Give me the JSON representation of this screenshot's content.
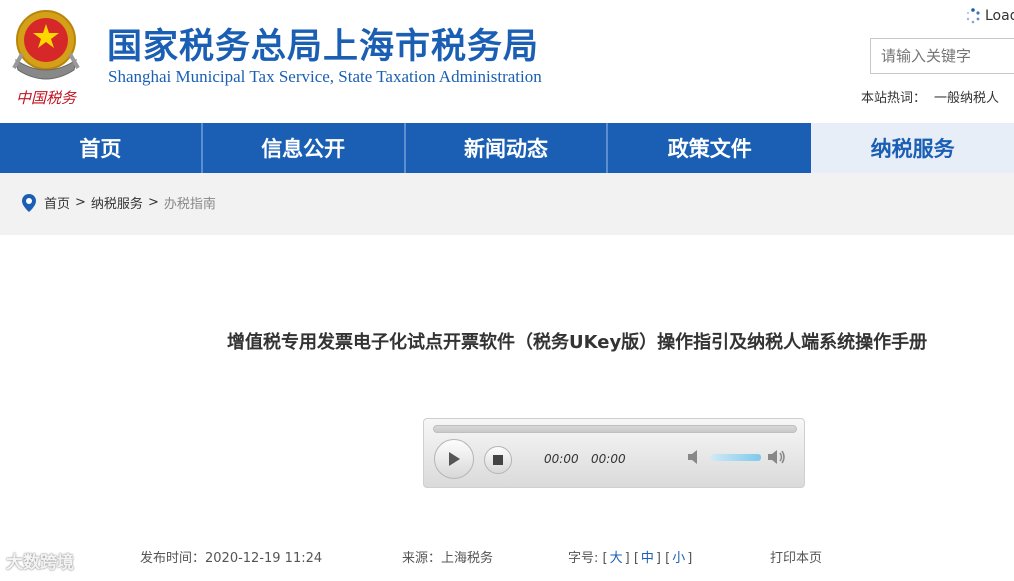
{
  "header": {
    "emblem_text": "中国税务",
    "title_cn": "国家税务总局上海市税务局",
    "title_en": "Shanghai Municipal Tax Service, State Taxation Administration",
    "loader_text": "Load",
    "search_placeholder": "请输入关键字",
    "hot_label": "本站热词：",
    "hot_word": "一般纳税人"
  },
  "nav": {
    "items": [
      {
        "label": "首页"
      },
      {
        "label": "信息公开"
      },
      {
        "label": "新闻动态"
      },
      {
        "label": "政策文件"
      },
      {
        "label": "纳税服务"
      }
    ],
    "active_index": 4
  },
  "breadcrumb": {
    "home": "首页",
    "sep": ">",
    "level1": "纳税服务",
    "current": "办税指南"
  },
  "article": {
    "title": "增值税专用发票电子化试点开票软件（税务UKey版）操作指引及纳税人端系统操作手册",
    "publish": "发布时间：2020-12-19 11:24",
    "source": "来源：上海税务",
    "font_label": "字号:",
    "font_large": "大",
    "font_medium": "中",
    "font_small": "小",
    "print": "打印本页"
  },
  "player": {
    "current_time": "00:00",
    "duration": "00:00",
    "progress": 0,
    "volume": 0.8
  },
  "watermark": "大数跨境",
  "colors": {
    "brand_blue": "#1a5fb4",
    "nav_active_bg": "#e8eef8"
  }
}
